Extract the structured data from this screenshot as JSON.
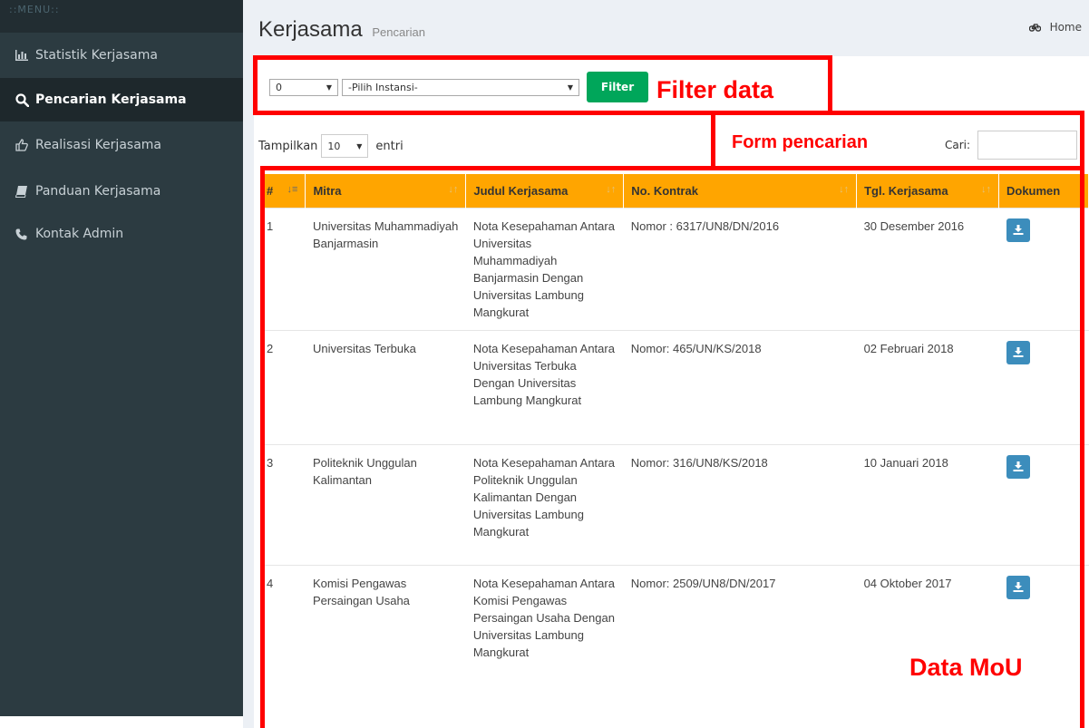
{
  "sidebar": {
    "header": "::MENU::",
    "items": [
      {
        "label": "Statistik Kerjasama",
        "icon": "bar-chart-icon",
        "active": false
      },
      {
        "label": "Pencarian Kerjasama",
        "icon": "search-icon",
        "active": true
      },
      {
        "label": "Realisasi Kerjasama",
        "icon": "thumbs-up-icon",
        "active": false
      },
      {
        "label": "Panduan Kerjasama",
        "icon": "book-icon",
        "active": false
      },
      {
        "label": "Kontak Admin",
        "icon": "phone-icon",
        "active": false
      }
    ]
  },
  "header": {
    "title": "Kerjasama",
    "subtitle": "Pencarian",
    "breadcrumb_home": "Home",
    "breadcrumb_icon": "bicycle-icon"
  },
  "filter": {
    "year_value": "0",
    "instansi_value": "-Pilih Instansi-",
    "button_label": "Filter"
  },
  "table_controls": {
    "show_label": "Tampilkan",
    "page_length": "10",
    "entries_label": "entri",
    "search_label": "Cari:",
    "search_value": ""
  },
  "table": {
    "columns": [
      "#",
      "Mitra",
      "Judul Kerjasama",
      "No. Kontrak",
      "Tgl. Kerjasama",
      "Dokumen"
    ],
    "rows": [
      {
        "no": "1",
        "mitra": "Universitas Muhammadiyah Banjarmasin",
        "judul": "Nota Kesepahaman Antara Universitas Muhammadiyah Banjarmasin Dengan Universitas Lambung Mangkurat",
        "kontrak": "Nomor : 6317/UN8/DN/2016",
        "tanggal": "30 Desember 2016"
      },
      {
        "no": "2",
        "mitra": "Universitas Terbuka",
        "judul": "Nota Kesepahaman Antara Universitas Terbuka Dengan Universitas Lambung Mangkurat",
        "kontrak": "Nomor: 465/UN/KS/2018",
        "tanggal": "02 Februari 2018"
      },
      {
        "no": "3",
        "mitra": "Politeknik Unggulan Kalimantan",
        "judul": "Nota Kesepahaman Antara Politeknik Unggulan Kalimantan Dengan Universitas Lambung Mangkurat",
        "kontrak": "Nomor: 316/UN8/KS/2018",
        "tanggal": "10 Januari 2018"
      },
      {
        "no": "4",
        "mitra": "Komisi Pengawas Persaingan Usaha",
        "judul": "Nota Kesepahaman Antara Komisi Pengawas Persaingan Usaha Dengan Universitas Lambung Mangkurat",
        "kontrak": "Nomor: 2509/UN8/DN/2017",
        "tanggal": "04 Oktober 2017"
      }
    ]
  },
  "annotations": {
    "filter": "Filter data",
    "search": "Form pencarian",
    "data": "Data MoU",
    "color": "#ff0000"
  },
  "colors": {
    "sidebar_bg": "#2c3b41",
    "header_orange": "#ffa500",
    "filter_green": "#00a65a",
    "download_blue": "#3c8dbc"
  }
}
